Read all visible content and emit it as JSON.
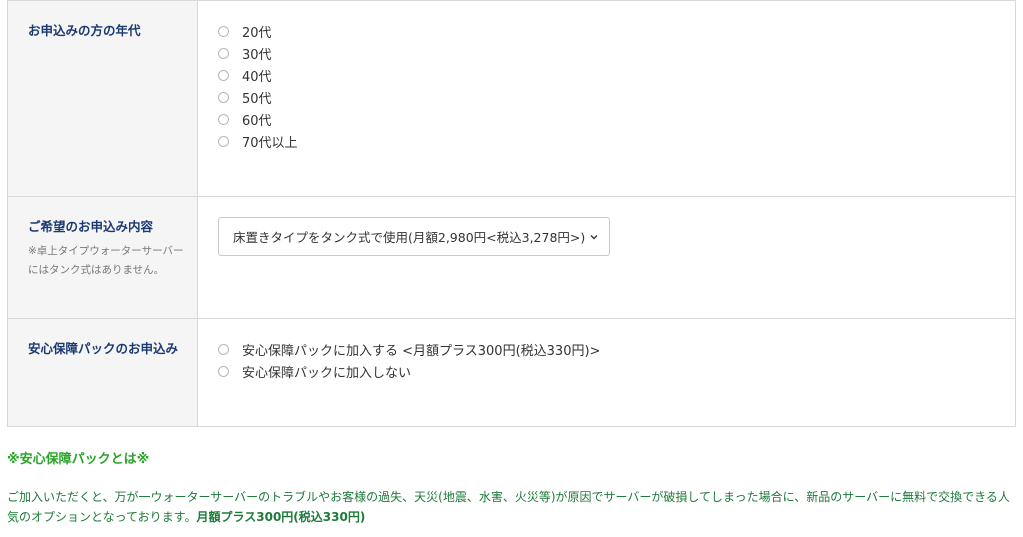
{
  "age_section": {
    "label": "お申込みの方の年代",
    "options": [
      "20代",
      "30代",
      "40代",
      "50代",
      "60代",
      "70代以上"
    ]
  },
  "plan_section": {
    "label": "ご希望のお申込み内容",
    "note": "※卓上タイプウォーターサーバーにはタンク式はありません。",
    "selected_value": "床置きタイプをタンク式で使用(月額2,980円<税込3,278円>)"
  },
  "pack_section": {
    "label": "安心保障パックのお申込み",
    "options": [
      "安心保障パックに加入する <月額プラス300円(税込330円)>",
      "安心保障パックに加入しない"
    ]
  },
  "pack_info": {
    "title": "※安心保障パックとは※",
    "description": "ご加入いただくと、万が一ウォーターサーバーのトラブルやお客様の過失、天災(地震、水害、火災等)が原因でサーバーが破損してしまった場合に、新品のサーバーに無料で交換できる人気のオプションとなっております。",
    "price_emphasis": "月額プラス300円(税込330円)"
  },
  "colors": {
    "label_navy": "#1c3a72",
    "info_green": "#2aa52a",
    "desc_green": "#1f7a3a",
    "label_bg": "#f5f5f5",
    "border": "#d8d8d8"
  },
  "icons": {
    "select_chevron": "chevron-down-icon"
  }
}
